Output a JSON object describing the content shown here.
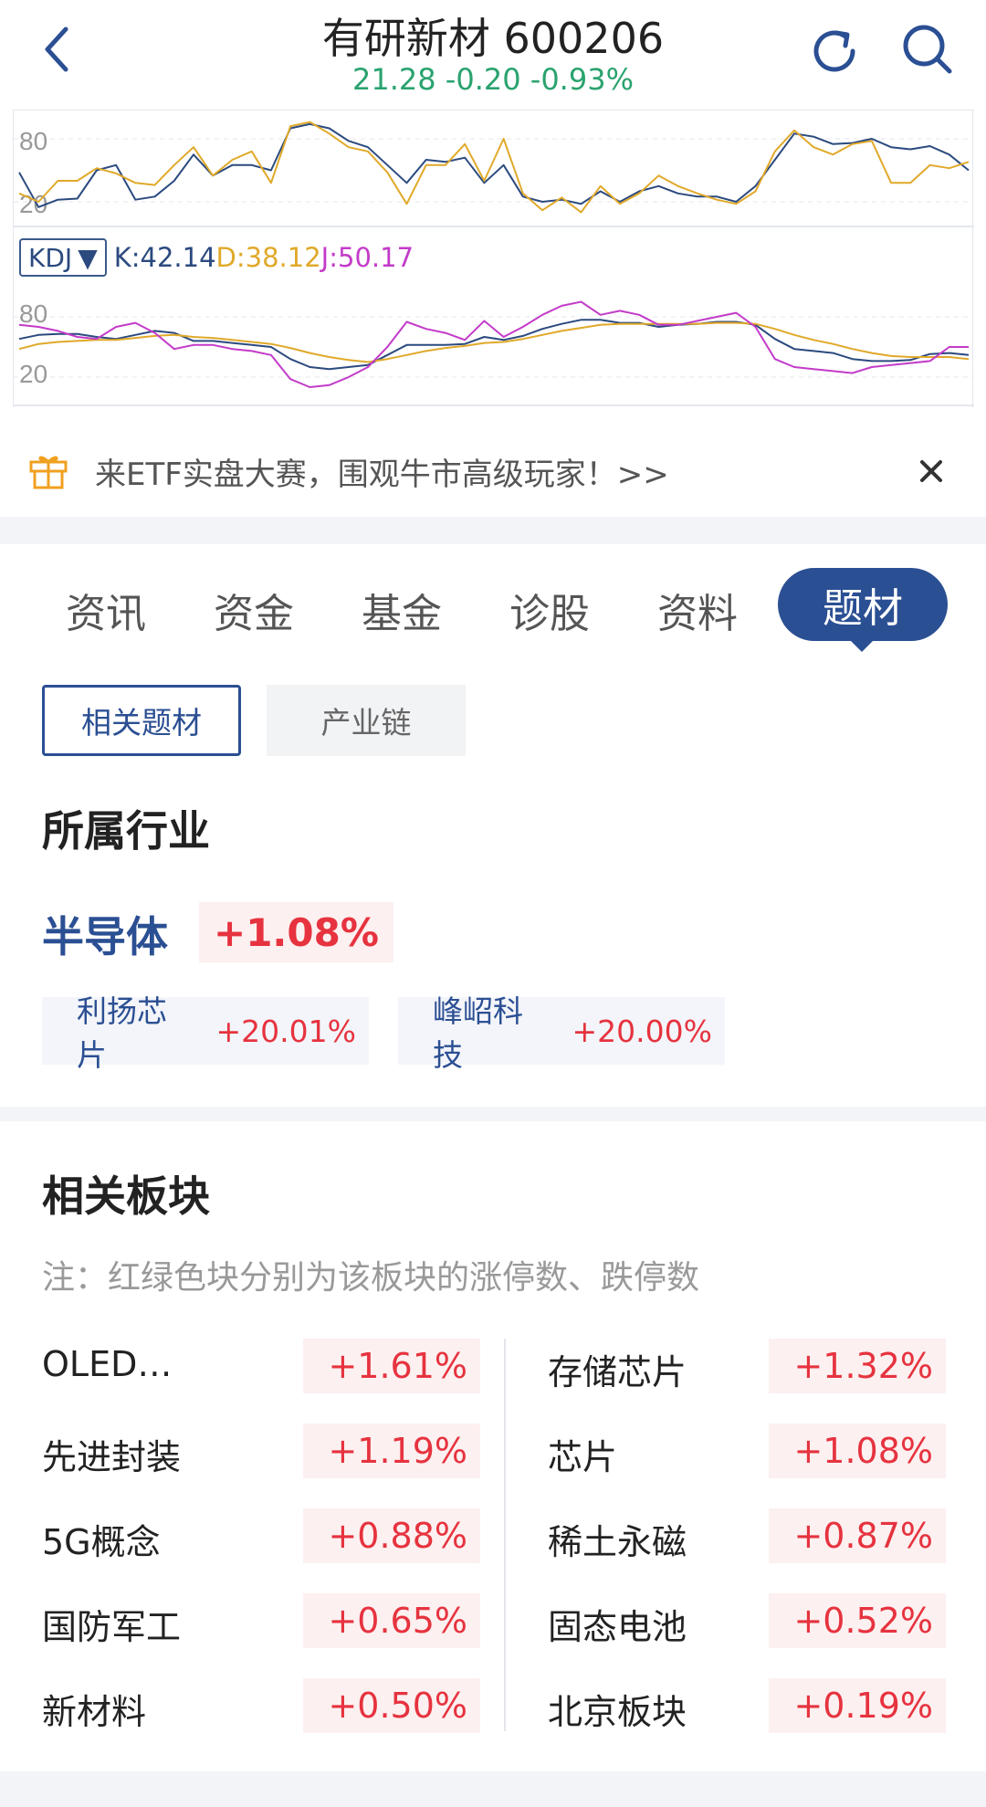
{
  "header": {
    "title": "有研新材 600206",
    "quote": "21.28 -0.20 -0.93%"
  },
  "chart_data": [
    {
      "type": "line",
      "ytick_labels": [
        "80",
        "20"
      ],
      "series": [
        {
          "color": "#2b4a7f",
          "values": [
            48,
            15,
            22,
            23,
            50,
            55,
            22,
            25,
            40,
            65,
            45,
            55,
            55,
            50,
            90,
            94,
            90,
            78,
            72,
            55,
            38,
            60,
            58,
            62,
            38,
            55,
            25,
            20,
            22,
            18,
            30,
            20,
            30,
            35,
            28,
            25,
            25,
            20,
            35,
            60,
            85,
            82,
            75,
            76,
            80,
            72,
            70,
            73,
            65,
            50
          ]
        },
        {
          "color": "#e0a92a",
          "values": [
            28,
            20,
            40,
            40,
            52,
            47,
            38,
            36,
            55,
            72,
            45,
            60,
            68,
            38,
            92,
            96,
            85,
            72,
            68,
            48,
            18,
            55,
            55,
            75,
            40,
            80,
            28,
            12,
            24,
            10,
            35,
            18,
            28,
            45,
            35,
            28,
            22,
            18,
            30,
            68,
            88,
            72,
            65,
            75,
            78,
            38,
            38,
            55,
            52,
            58
          ]
        }
      ]
    },
    {
      "type": "line",
      "indicator": "KDJ",
      "ytick_labels": [
        "80",
        "20"
      ],
      "series": [
        {
          "name": "K",
          "label": "K:42.14",
          "color": "#2b4a7f",
          "values": [
            58,
            62,
            63,
            63,
            60,
            58,
            62,
            66,
            64,
            56,
            56,
            54,
            52,
            50,
            38,
            30,
            28,
            30,
            32,
            42,
            52,
            52,
            52,
            53,
            60,
            57,
            61,
            68,
            73,
            77,
            77,
            74,
            74,
            70,
            72,
            73,
            75,
            75,
            72,
            58,
            48,
            46,
            44,
            38,
            36,
            36,
            37,
            43,
            44,
            42
          ]
        },
        {
          "name": "D",
          "label": "D:38.12",
          "color": "#e0a92a",
          "values": [
            48,
            53,
            55,
            56,
            57,
            57,
            59,
            61,
            62,
            60,
            59,
            57,
            55,
            53,
            49,
            44,
            40,
            37,
            35,
            38,
            42,
            46,
            49,
            51,
            54,
            55,
            58,
            62,
            66,
            69,
            72,
            73,
            73,
            73,
            73,
            73,
            74,
            74,
            73,
            68,
            62,
            57,
            53,
            48,
            44,
            41,
            40,
            40,
            40,
            38
          ]
        },
        {
          "name": "J",
          "label": "J:50.17",
          "color": "#c33bc9",
          "values": [
            72,
            70,
            66,
            60,
            58,
            70,
            74,
            64,
            48,
            52,
            52,
            48,
            46,
            42,
            18,
            10,
            12,
            20,
            30,
            50,
            75,
            68,
            64,
            57,
            76,
            60,
            70,
            82,
            91,
            95,
            82,
            86,
            82,
            72,
            72,
            76,
            80,
            84,
            70,
            38,
            30,
            28,
            26,
            24,
            30,
            32,
            34,
            36,
            50,
            50
          ]
        }
      ]
    }
  ],
  "kdj": {
    "select_label": "KDJ",
    "k_label": "K:42.14",
    "d_label": "D:38.12",
    "j_label": "J:50.17"
  },
  "banner": {
    "text": "来ETF实盘大赛，围观牛市高级玩家！>>"
  },
  "tabs": [
    {
      "label": "资讯"
    },
    {
      "label": "资金"
    },
    {
      "label": "基金"
    },
    {
      "label": "诊股"
    },
    {
      "label": "资料"
    },
    {
      "label": "题材",
      "active": true
    }
  ],
  "subtabs": {
    "related": "相关题材",
    "chain": "产业链"
  },
  "industry": {
    "section_title": "所属行业",
    "name": "半导体",
    "change": "+1.08%",
    "stocks": [
      {
        "name": "利扬芯片",
        "change": "+20.01%"
      },
      {
        "name": "峰岹科技",
        "change": "+20.00%"
      }
    ]
  },
  "related": {
    "section_title": "相关板块",
    "note": "注：红绿色块分别为该板块的涨停数、跌停数",
    "left": [
      {
        "name": "OLED…",
        "change": "+1.61%"
      },
      {
        "name": "先进封装",
        "change": "+1.19%"
      },
      {
        "name": "5G概念",
        "change": "+0.88%"
      },
      {
        "name": "国防军工",
        "change": "+0.65%"
      },
      {
        "name": "新材料",
        "change": "+0.50%"
      }
    ],
    "right": [
      {
        "name": "存储芯片",
        "change": "+1.32%"
      },
      {
        "name": "芯片",
        "change": "+1.08%"
      },
      {
        "name": "稀土永磁",
        "change": "+0.87%"
      },
      {
        "name": "固态电池",
        "change": "+0.52%"
      },
      {
        "name": "北京板块",
        "change": "+0.19%"
      }
    ]
  },
  "colors": {
    "accent": "#2b4f93",
    "rise": "#e6333f",
    "fall": "#2aa36f"
  }
}
